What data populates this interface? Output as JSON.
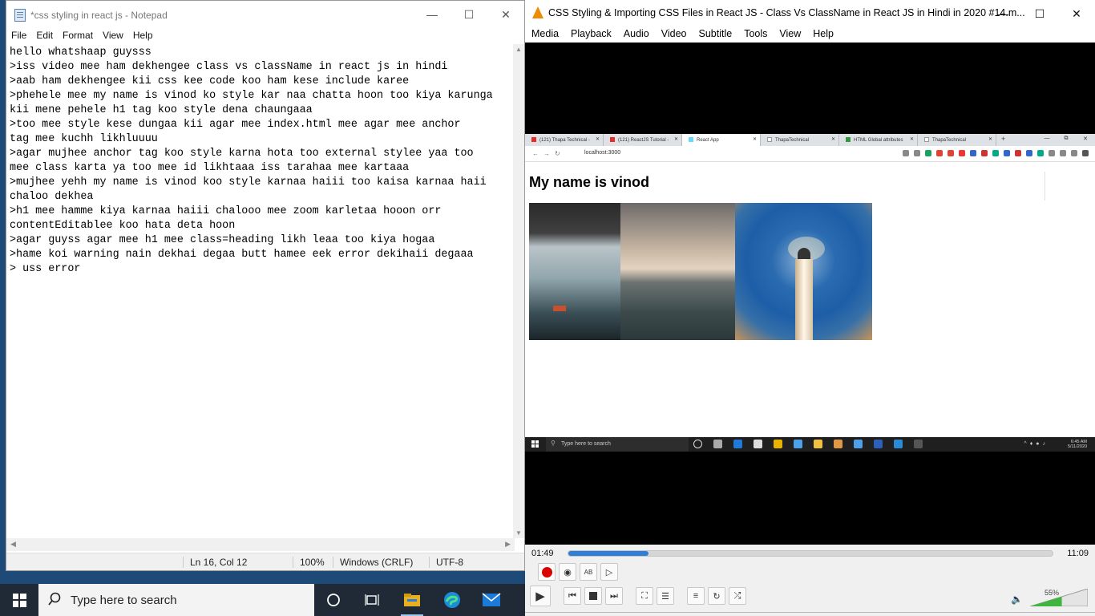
{
  "notepad": {
    "title": "*css styling in react js - Notepad",
    "menu": [
      "File",
      "Edit",
      "Format",
      "View",
      "Help"
    ],
    "lines": [
      "hello whatshaap guysss",
      ">iss video mee ham dekhengee class vs className in react js in hindi",
      ">aab ham dekhengee kii css kee code koo ham kese include karee",
      ">phehele mee my name is vinod ko style kar naa chatta hoon too kiya karunga",
      "kii mene pehele h1 tag koo style dena chaungaaa",
      ">too mee style kese dungaa kii agar mee index.html mee agar mee anchor",
      "tag mee kuchh likhluuuu",
      ">agar mujhee anchor tag koo style karna hota too external stylee yaa too",
      "mee class karta ya too mee id likhtaaa iss tarahaa mee kartaaa",
      ">mujhee yehh my name is vinod koo style karnaa haiii too kaisa karnaa haii",
      "chaloo dekhea",
      ">h1 mee hamme kiya karnaa haiii chalooo mee zoom karletaa hooon orr",
      "contentEditablee koo hata deta hoon",
      ">agar guyss agar mee h1 mee class=heading likh leaa too kiya hogaa",
      ">hame koi warning nain dekhai degaa butt hamee eek error dekihaii degaaa",
      "> uss error"
    ],
    "status": {
      "position": "Ln 16, Col 12",
      "zoom": "100%",
      "line_ending": "Windows (CRLF)",
      "encoding": "UTF-8"
    }
  },
  "vlc": {
    "title": "CSS Styling & Importing CSS Files in React JS - Class Vs ClassName in React JS in Hindi in 2020 #14.m...",
    "menu": [
      "Media",
      "Playback",
      "Audio",
      "Video",
      "Subtitle",
      "Tools",
      "View",
      "Help"
    ],
    "time_current": "01:49",
    "time_total": "11:09",
    "progress": 0.165,
    "volume": "55%",
    "volume_level": 0.55
  },
  "video": {
    "tabs": [
      {
        "label": "(121) Thapa Technical -",
        "favicon_color": "#e52d27"
      },
      {
        "label": "(121) ReactJS Tutorial -",
        "favicon_color": "#e52d27"
      },
      {
        "label": "React App",
        "favicon_color": "#61dafb"
      },
      {
        "label": "ThapaTechnical",
        "favicon_color": "#ffffff"
      },
      {
        "label": "HTML Global attributes",
        "favicon_color": "#2e9a3a"
      },
      {
        "label": "ThapaTechnical",
        "favicon_color": "#ffffff"
      }
    ],
    "url": "localhost:3000",
    "heading": "My name is vinod",
    "taskbar_search": "Type here to search",
    "tray_time": "6:45 AM",
    "tray_date": "5/11/2020"
  },
  "taskbar": {
    "search_placeholder": "Type here to search"
  },
  "colors": {
    "vlc_accent": "#f08a00",
    "seek_fill": "#2f7fd8",
    "record": "#d90000",
    "taskbar": "#1f2a36"
  }
}
